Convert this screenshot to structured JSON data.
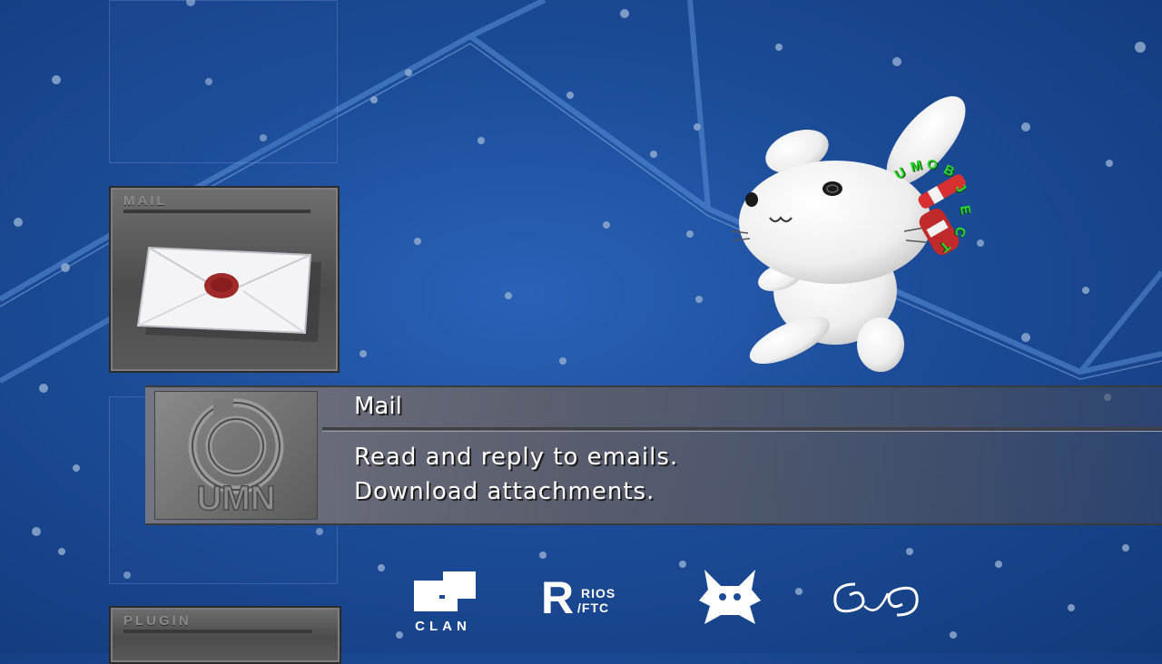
{
  "menu": {
    "selected_card_label": "MAIL",
    "lower_card_label": "PLUGIN"
  },
  "info_panel": {
    "title": "Mail",
    "lines": [
      "Read and reply to emails.",
      "Download attachments."
    ]
  },
  "mascot": {
    "orbit_text": [
      "U",
      "M",
      "O",
      "B",
      "J",
      "E",
      "C",
      "T"
    ]
  },
  "footer_logos": {
    "clan_label": "CLAN",
    "rios_big": "R",
    "rios_small_1": "RIOS",
    "rios_small_2": "/FTC"
  },
  "icons": [
    "envelope-icon",
    "umn-logo-icon",
    "clan-logo-icon",
    "rios-logo-icon",
    "rabbit-logo-icon",
    "swirl-logo-icon"
  ],
  "colors": {
    "background": "#1c4c98",
    "panel": "#6e6e76",
    "orbit_text": "#2bd92b",
    "text": "#ffffff"
  }
}
